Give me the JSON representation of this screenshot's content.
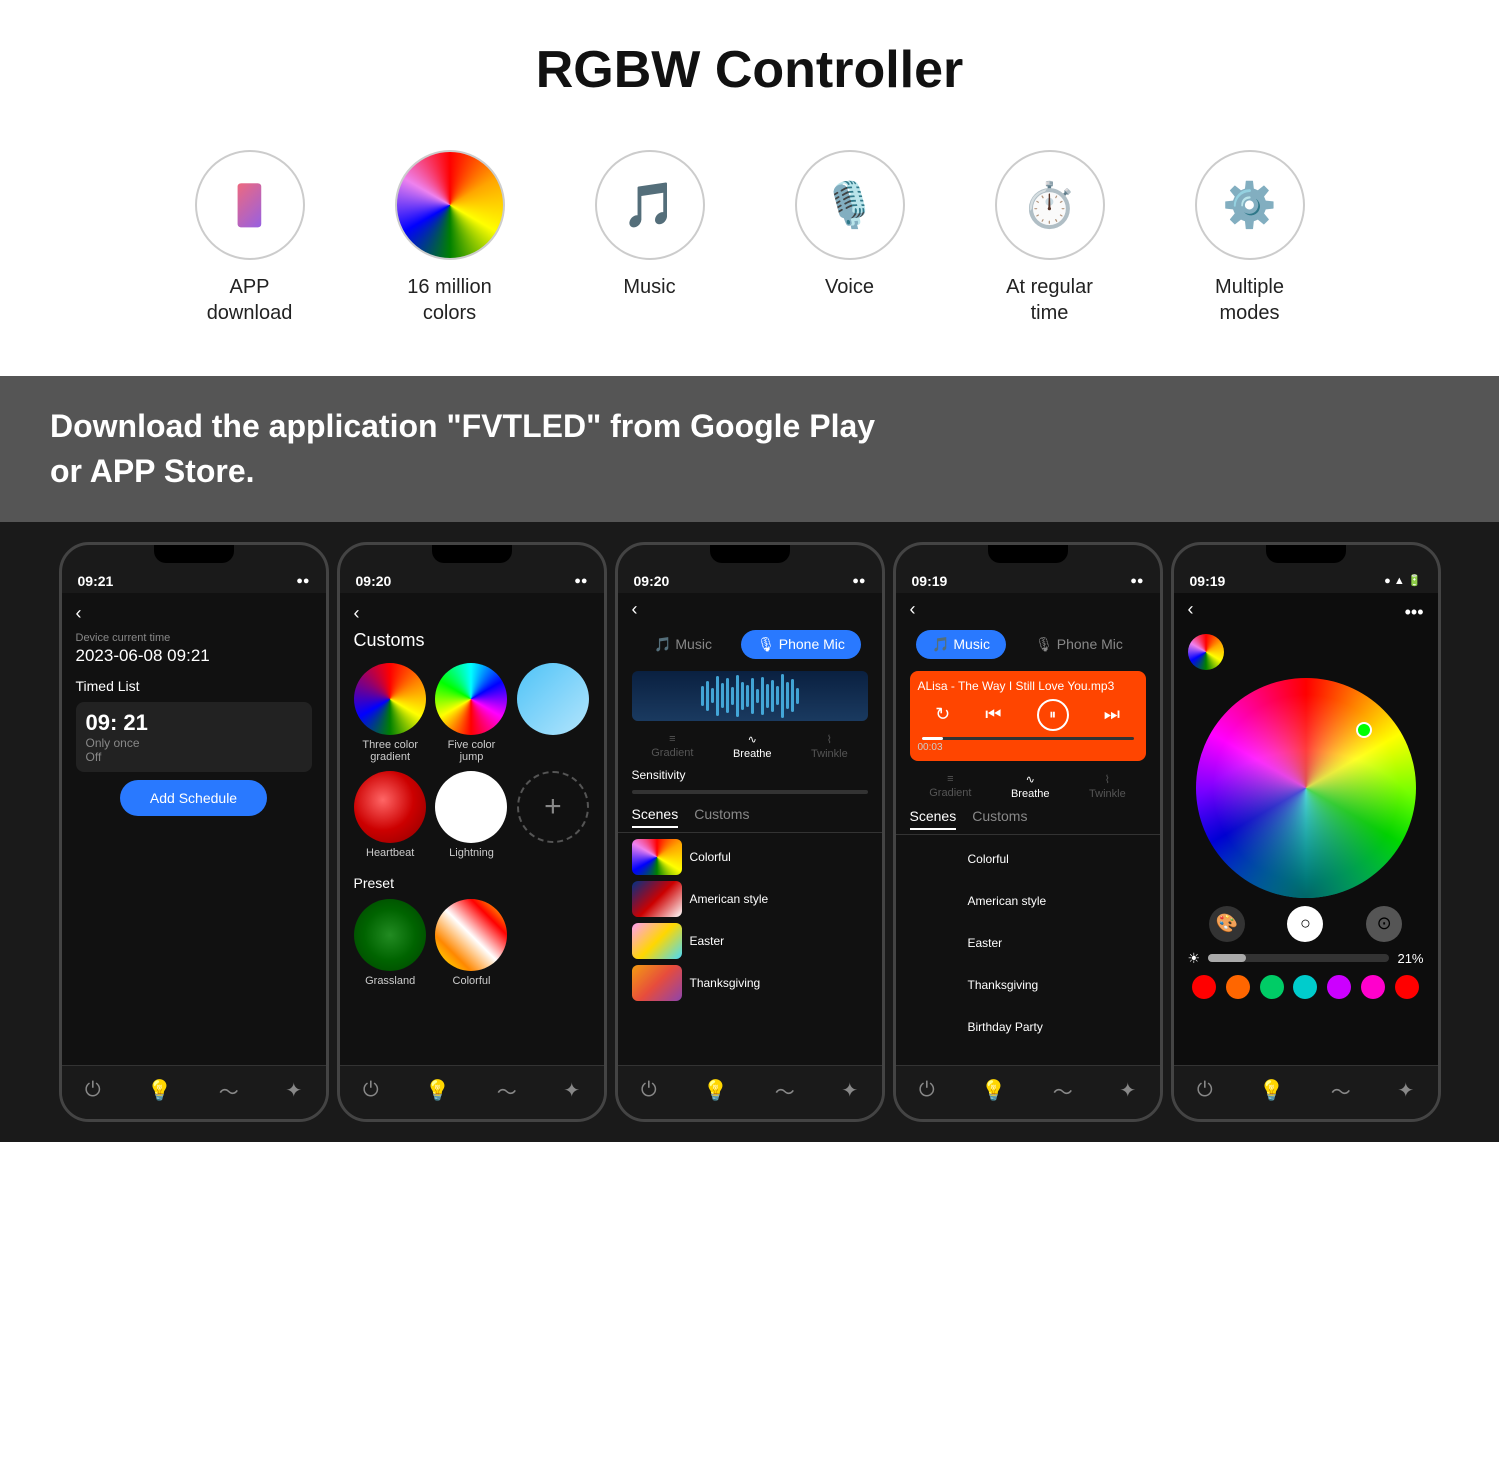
{
  "title": "RGBW Controller",
  "features": [
    {
      "label": "APP\ndownload",
      "icon": "📱",
      "id": "app-download"
    },
    {
      "label": "16 million\ncolors",
      "icon": "🌈",
      "id": "colors"
    },
    {
      "label": "Music",
      "icon": "🎵",
      "id": "music"
    },
    {
      "label": "Voice",
      "icon": "🎙️",
      "id": "voice"
    },
    {
      "label": "At regular\ntime",
      "icon": "⏱️",
      "id": "timer"
    },
    {
      "label": "Multiple\nmodes",
      "icon": "⚙️",
      "id": "modes"
    }
  ],
  "download_banner": "Download the application \"FVTLED\" from Google Play\nor APP Store.",
  "phones": {
    "phone1": {
      "time": "09:21",
      "device_time_label": "Device current time",
      "device_time": "2023-06-08 09:21",
      "list_title": "Timed List",
      "schedule": {
        "time": "09: 21",
        "repeat": "Only once",
        "status": "Off"
      },
      "add_button": "Add Schedule"
    },
    "phone2": {
      "time": "09:20",
      "title": "Customs",
      "customs_items": [
        {
          "label": "Three color gradient",
          "type": "gradient-3"
        },
        {
          "label": "Five color jump",
          "type": "gradient-5"
        },
        {
          "label": "",
          "type": "extra"
        },
        {
          "label": "Heartbeat",
          "type": "heartbeat"
        },
        {
          "label": "Lightning",
          "type": "lightning"
        },
        {
          "label": "+",
          "type": "plus"
        }
      ],
      "preset_title": "Preset",
      "preset_items": [
        {
          "label": "Grassland",
          "type": "grassland"
        },
        {
          "label": "Colorful",
          "type": "colorful"
        }
      ]
    },
    "phone3": {
      "time": "09:20",
      "tabs": [
        "Music",
        "Phone Mic"
      ],
      "active_tab": "Phone Mic",
      "modes": [
        "Gradient",
        "Breathe",
        "Twinkle"
      ],
      "active_mode": "Breathe",
      "sensitivity_label": "Sensitivity",
      "scenes_tabs": [
        "Scenes",
        "Customs"
      ],
      "active_scenes_tab": "Scenes",
      "scenes": [
        {
          "name": "Colorful",
          "type": "colorful-thumb"
        },
        {
          "name": "American style",
          "type": "american-thumb"
        },
        {
          "name": "Easter",
          "type": "easter-thumb"
        },
        {
          "name": "Thanksgiving",
          "type": "thanksgiving-thumb"
        }
      ]
    },
    "phone4": {
      "time": "09:19",
      "tabs": [
        "Music",
        "Phone Mic"
      ],
      "active_tab": "Music",
      "song": "ALisa - The Way I Still Love You.mp3",
      "song_time": "00:03",
      "modes": [
        "Gradient",
        "Breathe",
        "Twinkle"
      ],
      "active_mode": "Breathe",
      "scenes_tabs": [
        "Scenes",
        "Customs"
      ],
      "active_scenes_tab": "Scenes",
      "scenes": [
        {
          "name": "Colorful",
          "type": "colorful-thumb"
        },
        {
          "name": "American style",
          "type": "american-thumb"
        },
        {
          "name": "Easter",
          "type": "easter-thumb"
        },
        {
          "name": "Thanksgiving",
          "type": "thanksgiving-thumb"
        },
        {
          "name": "Birthday Party",
          "type": "easter-thumb"
        }
      ]
    },
    "phone5": {
      "time": "09:19",
      "brightness_value": "21%",
      "colors": [
        "#ff0000",
        "#ff6600",
        "#00cc66",
        "#00cccc",
        "#cc00ff",
        "#ff00cc",
        "#ff0000"
      ]
    }
  }
}
